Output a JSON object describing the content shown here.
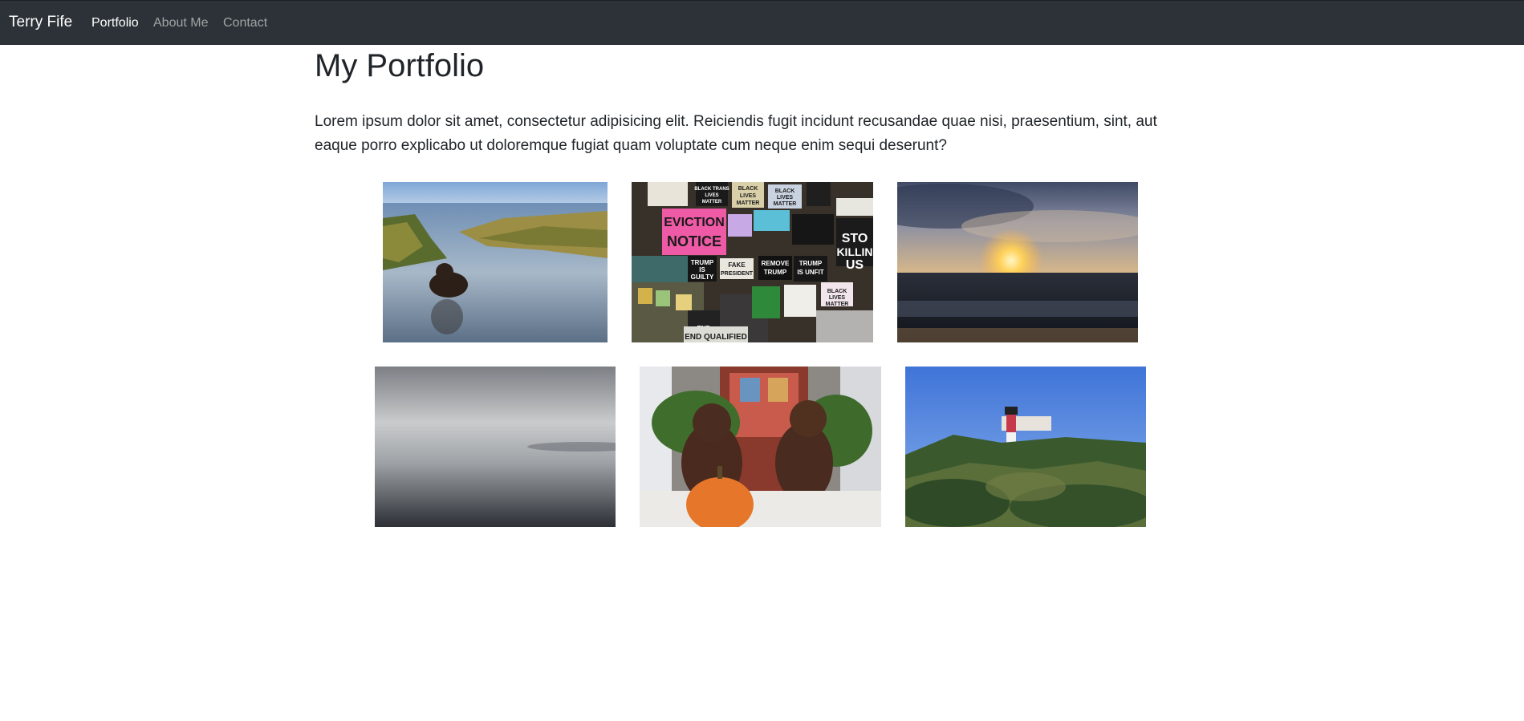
{
  "navbar": {
    "brand": "Terry Fife",
    "links": [
      {
        "label": "Portfolio",
        "active": true
      },
      {
        "label": "About Me",
        "active": false
      },
      {
        "label": "Contact",
        "active": false
      }
    ]
  },
  "main": {
    "title": "My Portfolio",
    "intro": "Lorem ipsum dolor sit amet, consectetur adipisicing elit. Reiciendis fugit incidunt recusandae quae nisi, praesentium, sint, aut eaque porro explicabo ut doloremque fugiat quam voluptate cum neque enim sequi deserunt?"
  },
  "gallery": {
    "photos": [
      {
        "subject": "dog-in-marsh-water"
      },
      {
        "subject": "protest-signs-wall",
        "sign_text": [
          "EVICTION",
          "NOTICE",
          "BLACK TRANS LIVES MATTER",
          "BLACK LIVES MATTER",
          "TRUMP IS GUILTY",
          "FAKE PRESIDENT",
          "REMOVE TRUMP",
          "TRUMP IS UNFIT",
          "END QUALIFIED",
          "STOP KILLING US"
        ]
      },
      {
        "subject": "sunset-over-ocean"
      },
      {
        "subject": "foggy-water"
      },
      {
        "subject": "two-spaniels-with-pumpkin"
      },
      {
        "subject": "lighthouse-on-hill"
      }
    ]
  },
  "colors": {
    "navbar_bg": "#2c3237",
    "nav_active": "#ffffff",
    "nav_inactive": "#9a9da0",
    "text": "#212529"
  }
}
